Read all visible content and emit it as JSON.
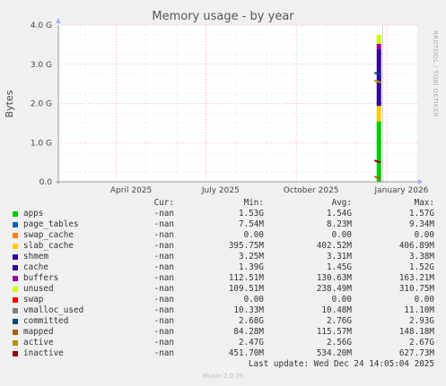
{
  "chart_data": {
    "type": "area",
    "title": "Memory usage - by year",
    "ylabel": "Bytes",
    "side_label": "RRDTOOL / TOBI OETIKER",
    "ylim": [
      0,
      4
    ],
    "y_ticks": [
      "0.0",
      "1.0 G",
      "2.0 G",
      "3.0 G",
      "4.0 G"
    ],
    "x_ticks": [
      "April 2025",
      "July 2025",
      "October 2025",
      "January 2026"
    ],
    "data_date": "2025-12-24",
    "stack_gb": [
      {
        "name": "apps",
        "color": "#00cc00",
        "value": 1.54
      },
      {
        "name": "shmem",
        "color": "#00ff00",
        "value": 0.00331
      },
      {
        "name": "slab_cache",
        "color": "#ffcc00",
        "value": 0.39
      },
      {
        "name": "swap_cache",
        "color": "#ff8000",
        "value": 0.0
      },
      {
        "name": "page_tables",
        "color": "#0066b3",
        "value": 0.008
      },
      {
        "name": "cache",
        "color": "#330099",
        "value": 1.45
      },
      {
        "name": "buffers",
        "color": "#990099",
        "value": 0.128
      },
      {
        "name": "unused",
        "color": "#ccff00",
        "value": 0.23
      }
    ],
    "marker_lines_gb": [
      {
        "name": "committed",
        "color": "#00487d",
        "value": 2.76
      },
      {
        "name": "active",
        "color": "#b38f00",
        "value": 2.56
      },
      {
        "name": "inactive",
        "color": "#990000",
        "value": 0.52
      },
      {
        "name": "mapped",
        "color": "#b35a00",
        "value": 0.11
      }
    ]
  },
  "legend": {
    "headers": {
      "cur": "Cur:",
      "min": "Min:",
      "avg": "Avg:",
      "max": "Max:"
    },
    "rows": [
      {
        "name": "apps",
        "color": "#00cc00",
        "cur": "-nan",
        "min": "1.53G",
        "avg": "1.54G",
        "max": "1.57G"
      },
      {
        "name": "page_tables",
        "color": "#0066b3",
        "cur": "-nan",
        "min": "7.54M",
        "avg": "8.23M",
        "max": "9.34M"
      },
      {
        "name": "swap_cache",
        "color": "#ff8000",
        "cur": "-nan",
        "min": "0.00",
        "avg": "0.00",
        "max": "0.00"
      },
      {
        "name": "slab_cache",
        "color": "#ffcc00",
        "cur": "-nan",
        "min": "395.75M",
        "avg": "402.52M",
        "max": "406.89M"
      },
      {
        "name": "shmem",
        "color": "#330099",
        "cur": "-nan",
        "min": "3.25M",
        "avg": "3.31M",
        "max": "3.38M"
      },
      {
        "name": "cache",
        "color": "#330099",
        "cur": "-nan",
        "min": "1.39G",
        "avg": "1.45G",
        "max": "1.52G"
      },
      {
        "name": "buffers",
        "color": "#990099",
        "cur": "-nan",
        "min": "112.51M",
        "avg": "130.63M",
        "max": "163.21M"
      },
      {
        "name": "unused",
        "color": "#ccff00",
        "cur": "-nan",
        "min": "109.51M",
        "avg": "238.49M",
        "max": "310.75M"
      },
      {
        "name": "swap",
        "color": "#ff0000",
        "cur": "-nan",
        "min": "0.00",
        "avg": "0.00",
        "max": "0.00"
      },
      {
        "name": "vmalloc_used",
        "color": "#808080",
        "cur": "-nan",
        "min": "10.33M",
        "avg": "10.48M",
        "max": "11.10M"
      },
      {
        "name": "committed",
        "color": "#00487d",
        "cur": "-nan",
        "min": "2.68G",
        "avg": "2.76G",
        "max": "2.93G"
      },
      {
        "name": "mapped",
        "color": "#b35a00",
        "cur": "-nan",
        "min": "84.28M",
        "avg": "115.57M",
        "max": "148.18M"
      },
      {
        "name": "active",
        "color": "#b38f00",
        "cur": "-nan",
        "min": "2.47G",
        "avg": "2.56G",
        "max": "2.67G"
      },
      {
        "name": "inactive",
        "color": "#990000",
        "cur": "-nan",
        "min": "451.70M",
        "avg": "534.20M",
        "max": "627.73M"
      }
    ],
    "last_update": "Last update: Wed Dec 24 14:05:04 2025"
  },
  "footer": "Munin 2.0.75"
}
